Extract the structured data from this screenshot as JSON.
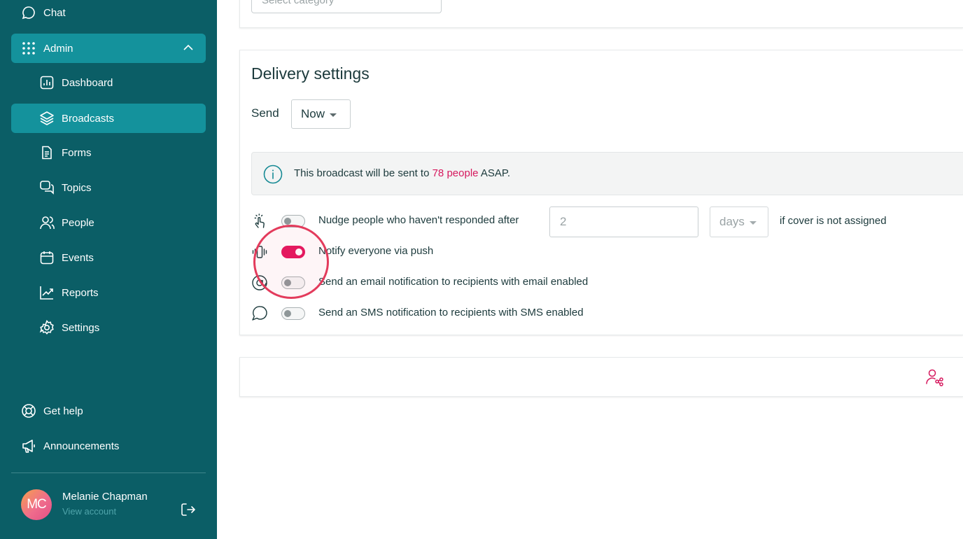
{
  "sidebar": {
    "items": [
      {
        "label": "Chat",
        "icon": "chat-icon"
      },
      {
        "label": "Admin",
        "icon": "grid-icon",
        "expanded": true
      },
      {
        "label": "Dashboard",
        "icon": "dashboard-icon"
      },
      {
        "label": "Broadcasts",
        "icon": "layers-icon",
        "active": true
      },
      {
        "label": "Forms",
        "icon": "form-icon"
      },
      {
        "label": "Topics",
        "icon": "topics-icon"
      },
      {
        "label": "People",
        "icon": "people-icon"
      },
      {
        "label": "Events",
        "icon": "calendar-icon"
      },
      {
        "label": "Reports",
        "icon": "reports-icon"
      },
      {
        "label": "Settings",
        "icon": "gear-icon"
      }
    ],
    "bottom": [
      {
        "label": "Get help",
        "icon": "lifebuoy-icon"
      },
      {
        "label": "Announcements",
        "icon": "megaphone-icon"
      }
    ],
    "user": {
      "initials": "MC",
      "name": "Melanie Chapman",
      "link": "View account"
    }
  },
  "top_card": {
    "category_placeholder": "Select category"
  },
  "delivery": {
    "title": "Delivery settings",
    "send_label": "Send",
    "send_value": "Now",
    "info": {
      "prefix": "This broadcast will be sent to ",
      "highlight": "78 people",
      "suffix": " ASAP."
    },
    "options": [
      {
        "label": "Nudge people who haven't responded after",
        "enabled": false,
        "icon": "tap-icon"
      },
      {
        "label": "Notify everyone via push",
        "enabled": true,
        "icon": "vibrate-icon"
      },
      {
        "label": "Send an email notification to recipients with email enabled",
        "enabled": false,
        "icon": "at-icon"
      },
      {
        "label": "Send an SMS notification to recipients with SMS enabled",
        "enabled": false,
        "icon": "sms-icon"
      }
    ],
    "nudge": {
      "value": "2",
      "unit": "days",
      "suffix": "if cover is not assigned"
    }
  },
  "colors": {
    "sidebar": "#0b5e66",
    "active": "#14929c",
    "accent": "#e4185f",
    "highlight_circle": "#e33b5c"
  }
}
